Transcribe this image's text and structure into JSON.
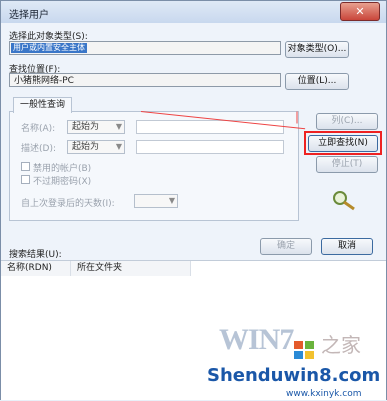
{
  "window": {
    "title": "选择用户",
    "close_glyph": "✕"
  },
  "object_type": {
    "label": "选择此对象类型(S):",
    "value": "用户或内置安全主体",
    "button": "对象类型(O)..."
  },
  "location": {
    "label": "查找位置(F):",
    "value": "小猪熊网络-PC",
    "button": "位置(L)..."
  },
  "tab": {
    "label": "一般性查询"
  },
  "query": {
    "name_label": "名称(A):",
    "name_mode": "起始为",
    "desc_label": "描述(D):",
    "desc_mode": "起始为",
    "disabled_accounts": "禁用的帐户(B)",
    "no_expire_pwd": "不过期密码(X)",
    "days_label": "自上次登录后的天数(I):"
  },
  "side_buttons": {
    "columns": "列(C)...",
    "find_now": "立即查找(N)",
    "stop": "停止(T)"
  },
  "footer": {
    "results_label": "搜索结果(U):",
    "ok": "确定",
    "cancel": "取消"
  },
  "results": {
    "columns": [
      "名称(RDN)",
      "所在文件夹"
    ]
  },
  "watermark": {
    "win": "WIN7",
    "home": "之家",
    "site": "Shenduwin8.com",
    "url": "www.kxinyk.com"
  }
}
